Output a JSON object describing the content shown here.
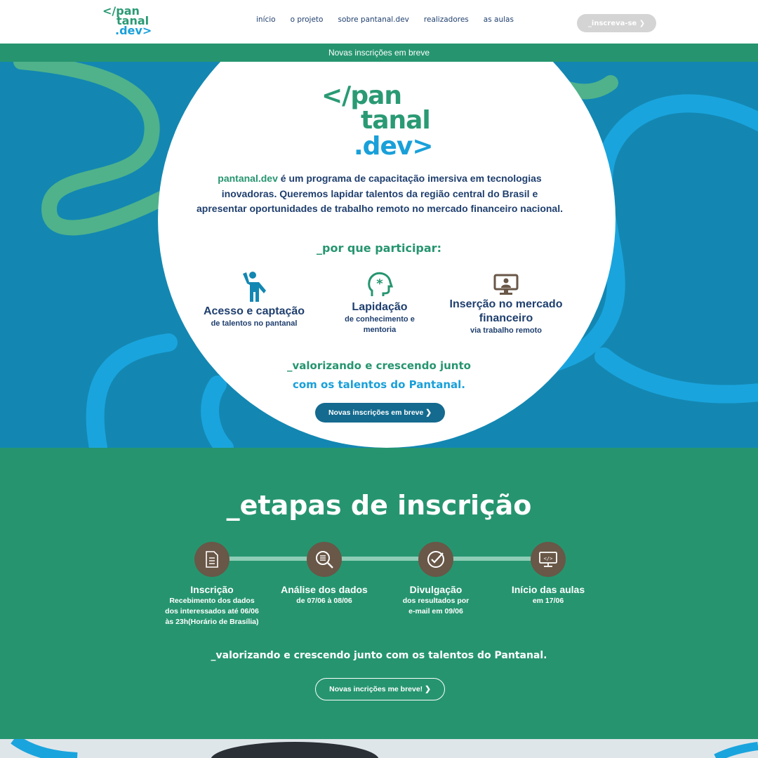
{
  "header": {
    "logo": {
      "line1": "</pan",
      "line2": "tanal",
      "line3": ".dev>"
    },
    "nav": [
      "início",
      "o projeto",
      "sobre pantanal.dev",
      "realizadores",
      "as aulas"
    ],
    "cta": "_inscreva-se ❯"
  },
  "banner": {
    "text": "Novas inscrições em breve"
  },
  "hero": {
    "logo": {
      "line1": "</pan",
      "line2": "tanal",
      "line3": ".dev>"
    },
    "intro_highlight": "pantanal.dev",
    "intro_rest": " é um programa de capacitação imersiva em tecnologias inovadoras. Queremos lapidar talentos da região central do Brasil e apresentar oportunidades de trabalho remoto no mercado financeiro nacional.",
    "why_title": "_por que participar:",
    "features": [
      {
        "title": "Acesso e captação",
        "subtitle": "de talentos no pantanal",
        "icon": "person-icon"
      },
      {
        "title": "Lapidação",
        "subtitle": "de conhecimento e mentoria",
        "icon": "brain-icon"
      },
      {
        "title": "Inserção no mercado financeiro",
        "subtitle": "via trabalho remoto",
        "icon": "remote-work-icon"
      }
    ],
    "tagline_line1": "_valorizando e crescendo junto",
    "tagline_line2": "com os talentos do Pantanal.",
    "button": "Novas inscrições em breve ❯"
  },
  "etapas": {
    "title": "_etapas de inscrição",
    "steps": [
      {
        "title": "Inscrição",
        "subtitle": "Recebimento dos dados dos interessados até 06/06 às 23h(Horário de Brasília)",
        "icon": "document-icon"
      },
      {
        "title": "Análise dos dados",
        "subtitle": "de 07/06 à 08/06",
        "icon": "magnifier-icon"
      },
      {
        "title": "Divulgação",
        "subtitle": "dos resultados por e-mail em 09/06",
        "icon": "check-circle-icon"
      },
      {
        "title": "Início das aulas",
        "subtitle": "em 17/06",
        "icon": "monitor-code-icon"
      }
    ],
    "tagline": "_valorizando e crescendo junto com os talentos do Pantanal.",
    "button": "Novas incrições me breve! ❯"
  },
  "colors": {
    "green": "#26956f",
    "blue": "#1387b2",
    "navy": "#1f3f6e",
    "light_blue": "#19a0d9",
    "brown": "#695747"
  }
}
